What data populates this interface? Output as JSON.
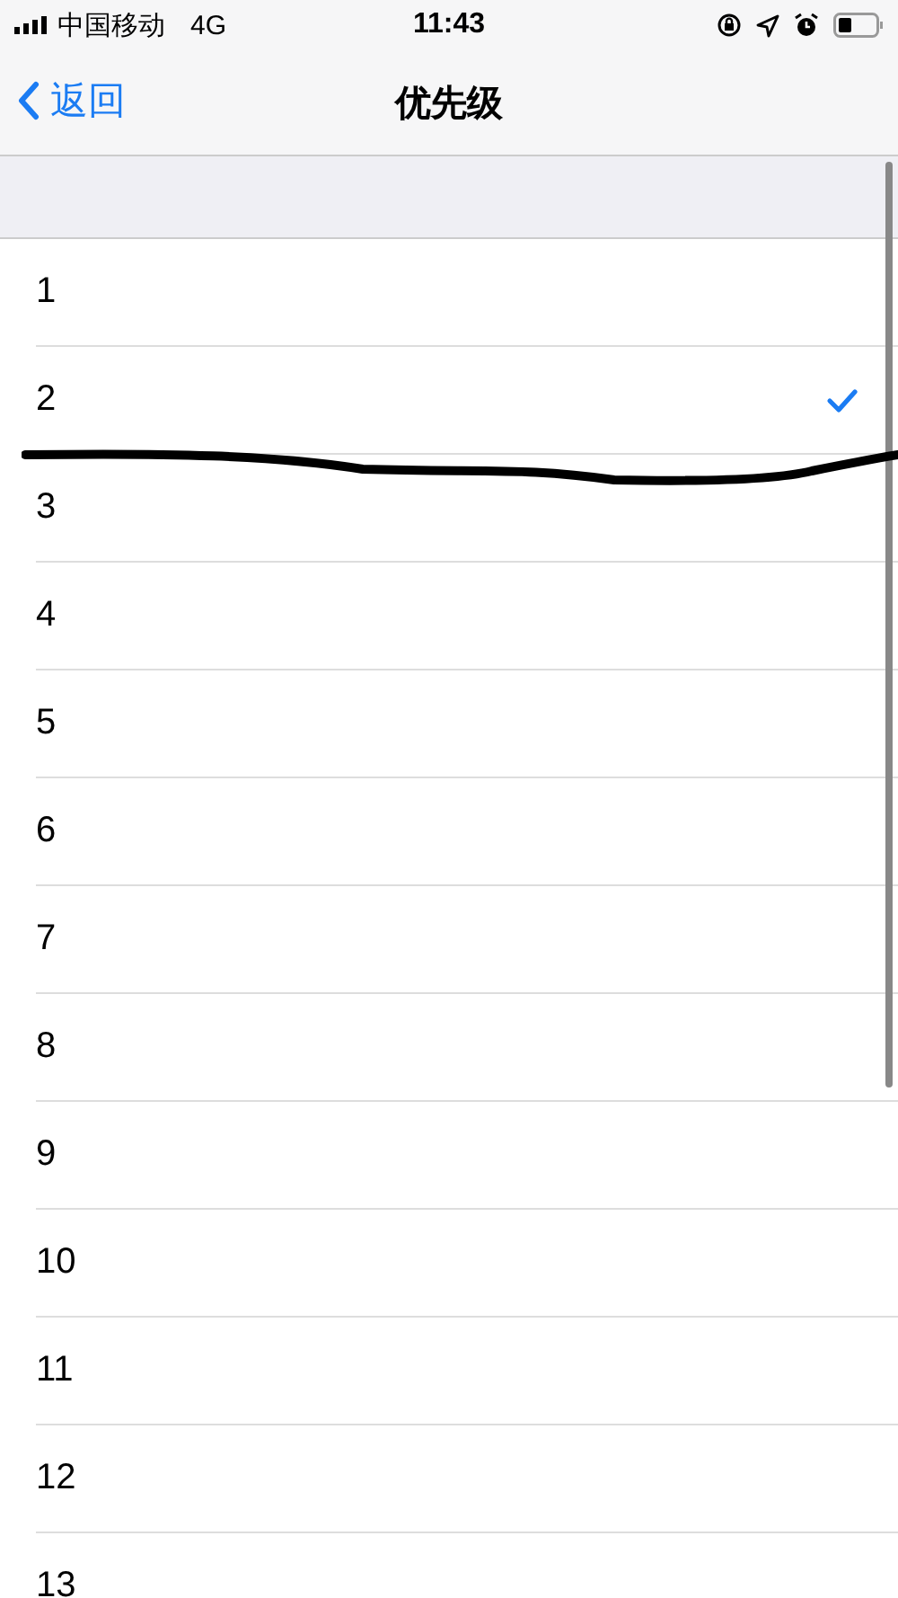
{
  "status_bar": {
    "carrier": "中国移动",
    "network": "4G",
    "time": "11:43"
  },
  "nav": {
    "back": "返回",
    "title": "优先级"
  },
  "options": [
    {
      "label": "1",
      "selected": false
    },
    {
      "label": "2",
      "selected": true
    },
    {
      "label": "3",
      "selected": false
    },
    {
      "label": "4",
      "selected": false
    },
    {
      "label": "5",
      "selected": false
    },
    {
      "label": "6",
      "selected": false
    },
    {
      "label": "7",
      "selected": false
    },
    {
      "label": "8",
      "selected": false
    },
    {
      "label": "9",
      "selected": false
    },
    {
      "label": "10",
      "selected": false
    },
    {
      "label": "11",
      "selected": false
    },
    {
      "label": "12",
      "selected": false
    },
    {
      "label": "13",
      "selected": false
    }
  ]
}
